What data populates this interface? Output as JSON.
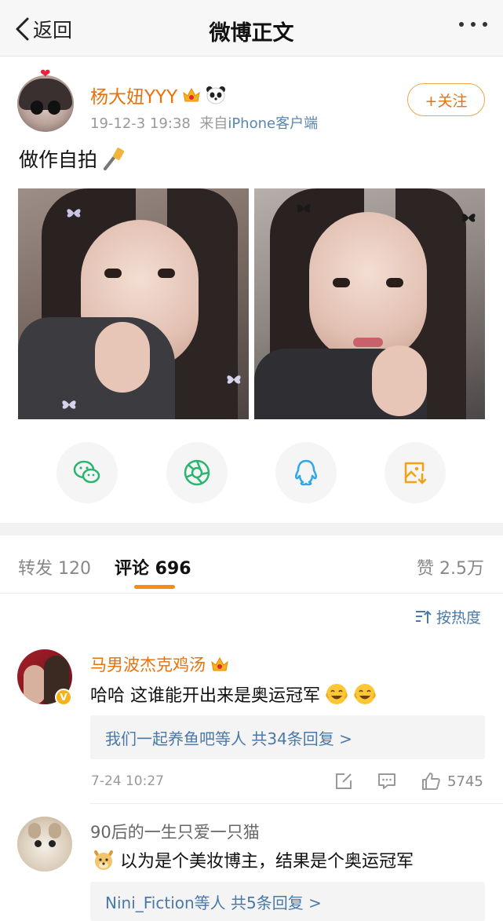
{
  "nav": {
    "back_label": "返回",
    "title": "微博正文"
  },
  "post": {
    "username": "杨大妞YYY",
    "time": "19-12-3 19:38",
    "source_prefix": "来自",
    "source": "iPhone客户端",
    "follow_label": "+关注",
    "text": "做作自拍"
  },
  "share_icons": [
    "wechat-icon",
    "moments-icon",
    "qq-icon",
    "save-image-icon"
  ],
  "tabs": {
    "repost": "转发 120",
    "comments": "评论 696",
    "likes": "赞 2.5万"
  },
  "sort_label": "按热度",
  "comments": [
    {
      "name": "马男波杰克鸡汤",
      "text": "哈哈 这谁能开出来是奥运冠军",
      "reply_who": "我们一起养鱼吧等人",
      "reply_count": "共34条回复 >",
      "time": "7-24 10:27",
      "likes": "5745"
    },
    {
      "name": "90后的一生只爱一只猫",
      "text": "以为是个美妆博主，结果是个奥运冠军",
      "reply_who": "Nini_Fiction等人",
      "reply_count": "共5条回复 >"
    }
  ],
  "colors": {
    "accent": "#e8720c",
    "link": "#4a78a8",
    "tab_underline": "#f48b1c"
  }
}
